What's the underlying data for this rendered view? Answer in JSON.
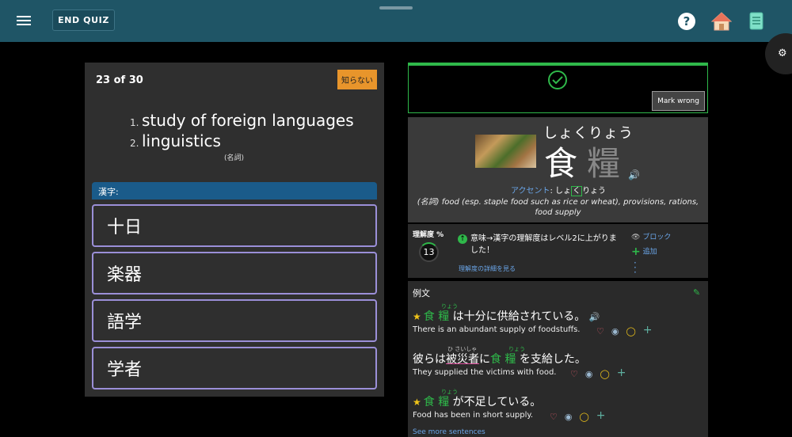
{
  "header": {
    "end_quiz_label": "END QUIZ",
    "help_icon": "?",
    "home_icon": "home-icon",
    "book_icon": "book-icon",
    "settings_icon": "gear-icon"
  },
  "quiz": {
    "counter": "23 of 30",
    "dont_know_label": "知らない",
    "meanings": [
      {
        "num": "1.",
        "text": "study of foreign languages"
      },
      {
        "num": "2.",
        "text": "linguistics"
      }
    ],
    "part_of_speech": "(名詞)",
    "kanji_label": "漢字:",
    "choices": [
      "十日",
      "楽器",
      "語学",
      "学者"
    ]
  },
  "result": {
    "mark_wrong_label": "Mark wrong"
  },
  "word": {
    "reading": "しょくりょう",
    "kanji_1": "食",
    "kanji_2": "糧",
    "accent_label": "アクセント",
    "accent_pre": ": しょ",
    "accent_hl": "く",
    "accent_post": "りょう",
    "definition": "(名詞) food (esp. staple food such as rice or wheat), provisions, rations, food supply"
  },
  "understanding": {
    "title": "理解度 %",
    "value": "13",
    "message": "意味→漢字の理解度はレベル2に上がりました！",
    "details_link": "理解度の詳細を見る",
    "block_label": "ブロック",
    "add_label": "追加"
  },
  "examples": {
    "title": "例文",
    "see_more": "See more sentences",
    "items": [
      {
        "jp_a": "食",
        "jp_b": "糧",
        "jp_rest": "は十分に供給されている。",
        "furi": "りょう",
        "en": "There is an abundant supply of foodstuffs."
      },
      {
        "jp_pre": "彼らは",
        "jp_pink": "被災者",
        "jp_mid": "に",
        "jp_a": "食",
        "jp_b": "糧",
        "jp_rest": "を支給した。",
        "furi_pink": "ひ さいしゃ",
        "furi": "りょう",
        "en": "They supplied the victims with food."
      },
      {
        "jp_a": "食",
        "jp_b": "糧",
        "jp_rest": "が不足している。",
        "furi": "りょう",
        "en": "Food has been in short supply."
      }
    ]
  }
}
